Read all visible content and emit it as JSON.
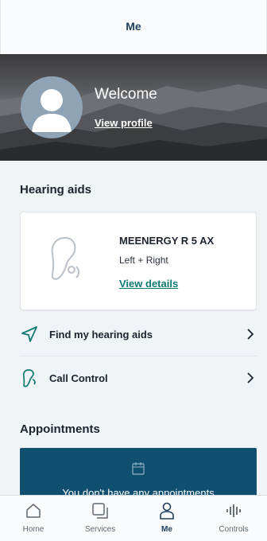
{
  "header": {
    "title": "Me"
  },
  "profile": {
    "welcome": "Welcome",
    "view_profile": "View profile"
  },
  "hearing_aids": {
    "section_title": "Hearing aids",
    "device_name": "MEENERGY R 5 AX",
    "side": "Left + Right",
    "view_details": "View details"
  },
  "actions": [
    {
      "label": "Find my hearing aids",
      "icon": "navigation-arrow-icon"
    },
    {
      "label": "Call Control",
      "icon": "hearing-aid-phone-icon"
    }
  ],
  "appointments": {
    "section_title": "Appointments",
    "empty_text": "You don't have any appointments"
  },
  "tabs": [
    {
      "label": "Home",
      "icon": "home-icon",
      "active": false
    },
    {
      "label": "Services",
      "icon": "services-icon",
      "active": false
    },
    {
      "label": "Me",
      "icon": "person-icon",
      "active": true
    },
    {
      "label": "Controls",
      "icon": "sound-wave-icon",
      "active": false
    }
  ],
  "colors": {
    "primary": "#1f3e5f",
    "accent_link": "#0e7a73",
    "appointment_card": "#114f71",
    "background": "#f1f4f7"
  }
}
